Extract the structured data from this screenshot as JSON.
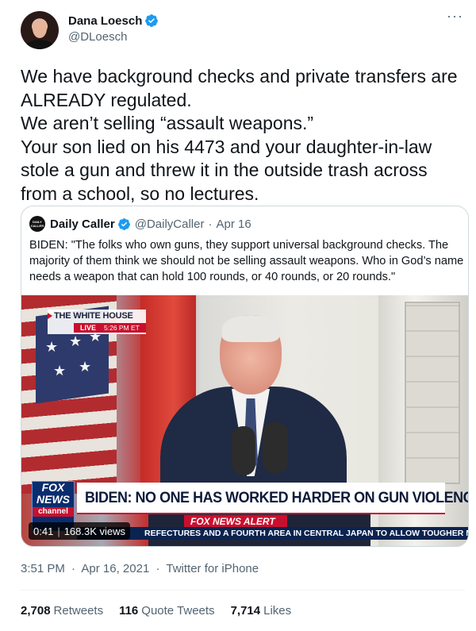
{
  "author": {
    "display_name": "Dana Loesch",
    "handle": "@DLoesch"
  },
  "tweet": {
    "text": "We have background checks and private transfers are ALREADY regulated.\nWe aren’t selling “assault weapons.”\nYour son lied on his 4473 and your daughter-in-law stole a gun and threw it in the outside trash across from a school, so no lectures."
  },
  "quote": {
    "avatar_label": "DAILY CALLER",
    "display_name": "Daily Caller",
    "handle": "@DailyCaller",
    "sep": "·",
    "date": "Apr 16",
    "text": "BIDEN: \"The folks who own guns, they support universal background checks. The majority of them think we should not be selling assault weapons. Who in God’s name needs a weapon that can hold 100 rounds, or 40 rounds, or 20 rounds.\"",
    "video": {
      "location": "THE WHITE HOUSE",
      "live": "LIVE",
      "time": "5:26 PM ET",
      "fox_line1": "FOX",
      "fox_line2": "NEWS",
      "fox_channel": "channel",
      "headline": "BIDEN: NO ONE HAS WORKED HARDER ON GUN VIOLENCE",
      "alert": "FOX NEWS ALERT",
      "ticker": "REFECTURES AND A FOURTH AREA IN CENTRAL JAPAN TO ALLOW TOUGHER MEASURES",
      "duration": "0:41",
      "views": "168.3K views"
    }
  },
  "meta": {
    "time": "3:51 PM",
    "sep": "·",
    "date": "Apr 16, 2021",
    "source": "Twitter for iPhone"
  },
  "stats": {
    "retweets_count": "2,708",
    "retweets_label": "Retweets",
    "quotes_count": "116",
    "quotes_label": "Quote Tweets",
    "likes_count": "7,714",
    "likes_label": "Likes"
  },
  "colors": {
    "verified": "#1d9bf0",
    "secondary_text": "#536471",
    "fox_red": "#c8102e"
  }
}
